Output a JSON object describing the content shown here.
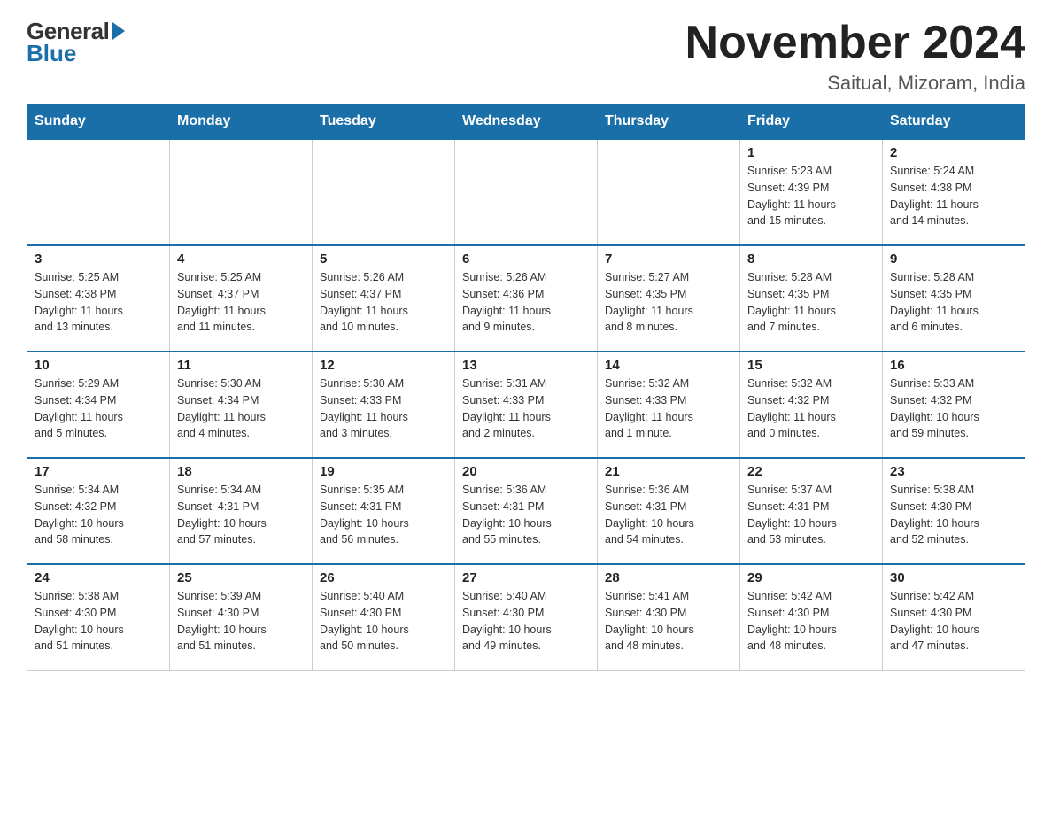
{
  "header": {
    "logo": {
      "general": "General",
      "blue": "Blue"
    },
    "title": "November 2024",
    "subtitle": "Saitual, Mizoram, India"
  },
  "calendar": {
    "days_of_week": [
      "Sunday",
      "Monday",
      "Tuesday",
      "Wednesday",
      "Thursday",
      "Friday",
      "Saturday"
    ],
    "weeks": [
      [
        {
          "day": "",
          "info": ""
        },
        {
          "day": "",
          "info": ""
        },
        {
          "day": "",
          "info": ""
        },
        {
          "day": "",
          "info": ""
        },
        {
          "day": "",
          "info": ""
        },
        {
          "day": "1",
          "info": "Sunrise: 5:23 AM\nSunset: 4:39 PM\nDaylight: 11 hours\nand 15 minutes."
        },
        {
          "day": "2",
          "info": "Sunrise: 5:24 AM\nSunset: 4:38 PM\nDaylight: 11 hours\nand 14 minutes."
        }
      ],
      [
        {
          "day": "3",
          "info": "Sunrise: 5:25 AM\nSunset: 4:38 PM\nDaylight: 11 hours\nand 13 minutes."
        },
        {
          "day": "4",
          "info": "Sunrise: 5:25 AM\nSunset: 4:37 PM\nDaylight: 11 hours\nand 11 minutes."
        },
        {
          "day": "5",
          "info": "Sunrise: 5:26 AM\nSunset: 4:37 PM\nDaylight: 11 hours\nand 10 minutes."
        },
        {
          "day": "6",
          "info": "Sunrise: 5:26 AM\nSunset: 4:36 PM\nDaylight: 11 hours\nand 9 minutes."
        },
        {
          "day": "7",
          "info": "Sunrise: 5:27 AM\nSunset: 4:35 PM\nDaylight: 11 hours\nand 8 minutes."
        },
        {
          "day": "8",
          "info": "Sunrise: 5:28 AM\nSunset: 4:35 PM\nDaylight: 11 hours\nand 7 minutes."
        },
        {
          "day": "9",
          "info": "Sunrise: 5:28 AM\nSunset: 4:35 PM\nDaylight: 11 hours\nand 6 minutes."
        }
      ],
      [
        {
          "day": "10",
          "info": "Sunrise: 5:29 AM\nSunset: 4:34 PM\nDaylight: 11 hours\nand 5 minutes."
        },
        {
          "day": "11",
          "info": "Sunrise: 5:30 AM\nSunset: 4:34 PM\nDaylight: 11 hours\nand 4 minutes."
        },
        {
          "day": "12",
          "info": "Sunrise: 5:30 AM\nSunset: 4:33 PM\nDaylight: 11 hours\nand 3 minutes."
        },
        {
          "day": "13",
          "info": "Sunrise: 5:31 AM\nSunset: 4:33 PM\nDaylight: 11 hours\nand 2 minutes."
        },
        {
          "day": "14",
          "info": "Sunrise: 5:32 AM\nSunset: 4:33 PM\nDaylight: 11 hours\nand 1 minute."
        },
        {
          "day": "15",
          "info": "Sunrise: 5:32 AM\nSunset: 4:32 PM\nDaylight: 11 hours\nand 0 minutes."
        },
        {
          "day": "16",
          "info": "Sunrise: 5:33 AM\nSunset: 4:32 PM\nDaylight: 10 hours\nand 59 minutes."
        }
      ],
      [
        {
          "day": "17",
          "info": "Sunrise: 5:34 AM\nSunset: 4:32 PM\nDaylight: 10 hours\nand 58 minutes."
        },
        {
          "day": "18",
          "info": "Sunrise: 5:34 AM\nSunset: 4:31 PM\nDaylight: 10 hours\nand 57 minutes."
        },
        {
          "day": "19",
          "info": "Sunrise: 5:35 AM\nSunset: 4:31 PM\nDaylight: 10 hours\nand 56 minutes."
        },
        {
          "day": "20",
          "info": "Sunrise: 5:36 AM\nSunset: 4:31 PM\nDaylight: 10 hours\nand 55 minutes."
        },
        {
          "day": "21",
          "info": "Sunrise: 5:36 AM\nSunset: 4:31 PM\nDaylight: 10 hours\nand 54 minutes."
        },
        {
          "day": "22",
          "info": "Sunrise: 5:37 AM\nSunset: 4:31 PM\nDaylight: 10 hours\nand 53 minutes."
        },
        {
          "day": "23",
          "info": "Sunrise: 5:38 AM\nSunset: 4:30 PM\nDaylight: 10 hours\nand 52 minutes."
        }
      ],
      [
        {
          "day": "24",
          "info": "Sunrise: 5:38 AM\nSunset: 4:30 PM\nDaylight: 10 hours\nand 51 minutes."
        },
        {
          "day": "25",
          "info": "Sunrise: 5:39 AM\nSunset: 4:30 PM\nDaylight: 10 hours\nand 51 minutes."
        },
        {
          "day": "26",
          "info": "Sunrise: 5:40 AM\nSunset: 4:30 PM\nDaylight: 10 hours\nand 50 minutes."
        },
        {
          "day": "27",
          "info": "Sunrise: 5:40 AM\nSunset: 4:30 PM\nDaylight: 10 hours\nand 49 minutes."
        },
        {
          "day": "28",
          "info": "Sunrise: 5:41 AM\nSunset: 4:30 PM\nDaylight: 10 hours\nand 48 minutes."
        },
        {
          "day": "29",
          "info": "Sunrise: 5:42 AM\nSunset: 4:30 PM\nDaylight: 10 hours\nand 48 minutes."
        },
        {
          "day": "30",
          "info": "Sunrise: 5:42 AM\nSunset: 4:30 PM\nDaylight: 10 hours\nand 47 minutes."
        }
      ]
    ]
  }
}
